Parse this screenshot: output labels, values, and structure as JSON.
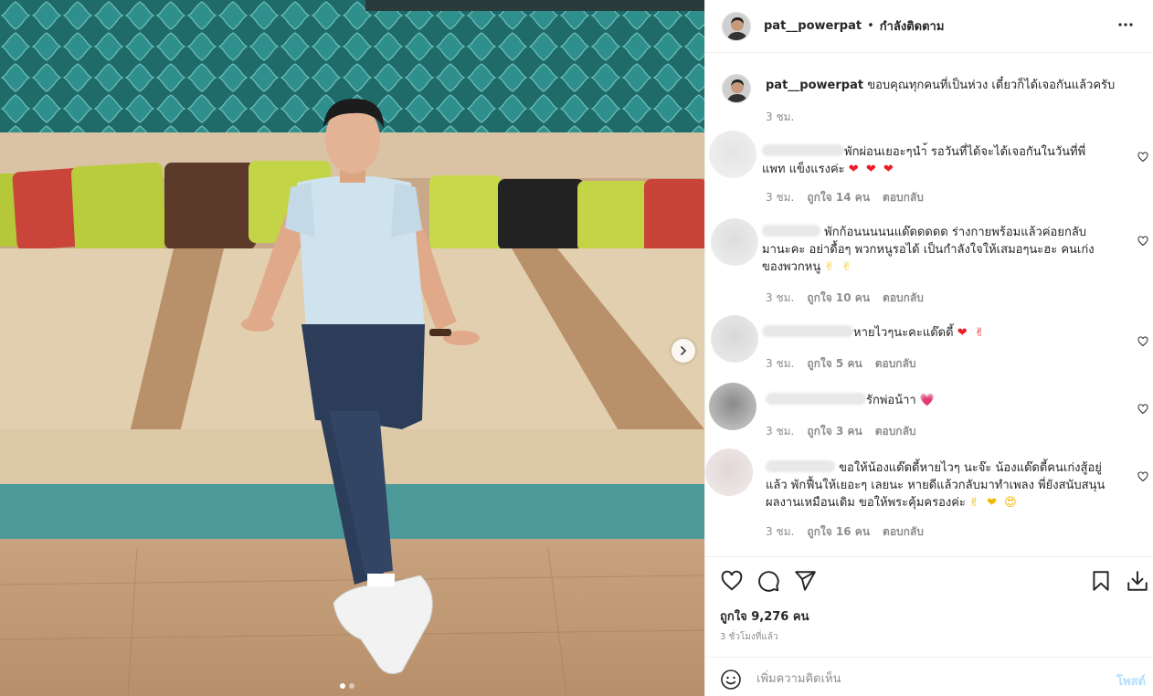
{
  "post": {
    "image_alt": "photo",
    "carousel_dots": 2,
    "carousel_active": 0
  },
  "header": {
    "username": "pat__powerpat",
    "separator": "•",
    "follow_status": "กำลังติดตาม"
  },
  "caption": {
    "username": "pat__powerpat",
    "text": "ขอบคุณทุกคนที่เป็นห่วง เดี๋ยวก็ได้เจอกันแล้วครับ",
    "time": "3 ชม."
  },
  "comments": [
    {
      "text": "พักผ่อนเยอะๆนำ้ รอวันที่ได้จะได้เจอกันในวันที่พี่แพท แข็งแรงค่ะ",
      "emoji": "❤ ❤ ❤",
      "time": "3 ชม.",
      "likes": "ถูกใจ 14 คน",
      "reply": "ตอบกลับ"
    },
    {
      "text": "พักก้อนนนนนแด๊ดดดดด ร่างกายพร้อมแล้วค่อยกลับมานะคะ อย่าดื้อๆ พวกหนูรอได้ เป็นกำลังใจให้เสมอๆนะฮะ คนเก่งของพวกหนู",
      "emoji": "✌ ✌",
      "time": "3 ชม.",
      "likes": "ถูกใจ 10 คน",
      "reply": "ตอบกลับ"
    },
    {
      "text": "หายไวๆนะคะแด๊ดดี้",
      "emoji": "❤ ✌",
      "time": "3 ชม.",
      "likes": "ถูกใจ 5 คน",
      "reply": "ตอบกลับ"
    },
    {
      "text": "รักพ่อน้าา",
      "emoji": "💗",
      "time": "3 ชม.",
      "likes": "ถูกใจ 3 คน",
      "reply": "ตอบกลับ"
    },
    {
      "text": "ขอให้น้องแด๊ดดี้หายไวๆ นะจ๊ะ น้องแด๊ดดี้คนเก่งสู้อยู่แล้ว พักฟื้นให้เยอะๆ เลยนะ หายดีแล้วกลับมาทำเพลง พี่ยังสนับสนุนผลงานเหมือนเดิม ขอให้พระคุ้มครองค่ะ",
      "emoji": "✌ ❤ 😍",
      "time": "3 ชม.",
      "likes": "ถูกใจ 16 คน",
      "reply": "ตอบกลับ"
    }
  ],
  "actions": {
    "like_count": "ถูกใจ 9,276 คน",
    "time_ago": "3 ชั่วโมงที่แล้ว"
  },
  "add_comment": {
    "placeholder": "เพิ่มความคิดเห็น",
    "post_label": "โพสต์"
  },
  "icons": [
    "more-icon",
    "heart-icon",
    "comment-icon",
    "share-icon",
    "bookmark-icon",
    "download-icon",
    "emoji-icon",
    "chevron-right-icon"
  ],
  "colors": {
    "like_red": "#ed1c24",
    "post_disabled": "#b2dffc",
    "muted": "#8e8e8e"
  }
}
